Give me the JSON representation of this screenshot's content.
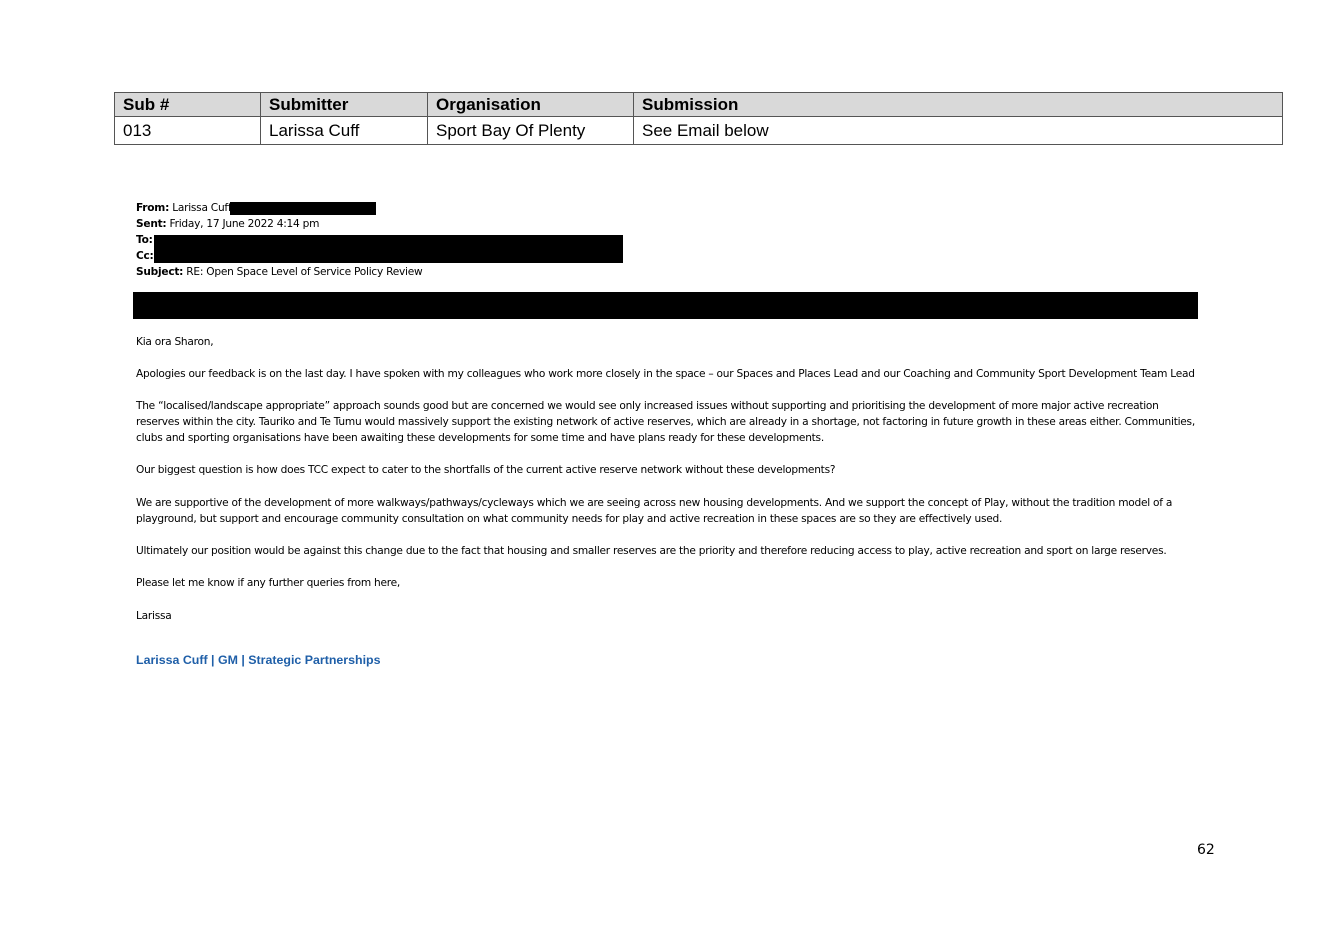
{
  "table": {
    "headers": [
      "Sub #",
      "Submitter",
      "Organisation",
      "Submission"
    ],
    "rows": [
      [
        "013",
        "Larissa Cuff",
        "Sport Bay Of Plenty",
        "See Email below"
      ]
    ]
  },
  "email": {
    "from_label": "From:",
    "from_value": "Larissa Cuff",
    "sent_label": "Sent:",
    "sent_value": "Friday, 17 June 2022 4:14 pm",
    "to_label": "To:",
    "cc_label": "Cc:",
    "subject_label": "Subject:",
    "subject_value": "RE: Open Space Level of Service Policy Review",
    "greeting": "Kia ora Sharon,",
    "paragraphs": [
      "Apologies our feedback is on the last day. I have spoken with my colleagues who work more closely in the space – our Spaces and Places Lead and our Coaching and Community Sport Development Team Lead",
      "The “localised/landscape appropriate” approach sounds good but are concerned we would see only increased issues without supporting and prioritising the development of more major active recreation reserves within the city. Tauriko and Te Tumu would massively support the existing network of active reserves, which are already in a shortage, not factoring in future growth in these areas either. Communities, clubs and sporting organisations have been awaiting these developments for some time and have plans ready for these developments.",
      "Our biggest question is how does TCC expect to cater to the shortfalls of the current active reserve network without these developments?",
      "We are supportive of the development of more walkways/pathways/cycleways which we are seeing across new housing developments. And we support the concept of Play, without the tradition model of a playground, but support and encourage community consultation on what community needs for play and active recreation in these spaces are so they are effectively used.",
      "Ultimately our position would be against this change due to the fact that housing and smaller reserves are the priority and therefore reducing access to play,  active recreation and sport on large reserves.",
      "Please let me know if any further queries from here,"
    ],
    "sign_off": "Larissa",
    "signature": "Larissa Cuff | GM | Strategic Partnerships"
  },
  "page_number": "62"
}
